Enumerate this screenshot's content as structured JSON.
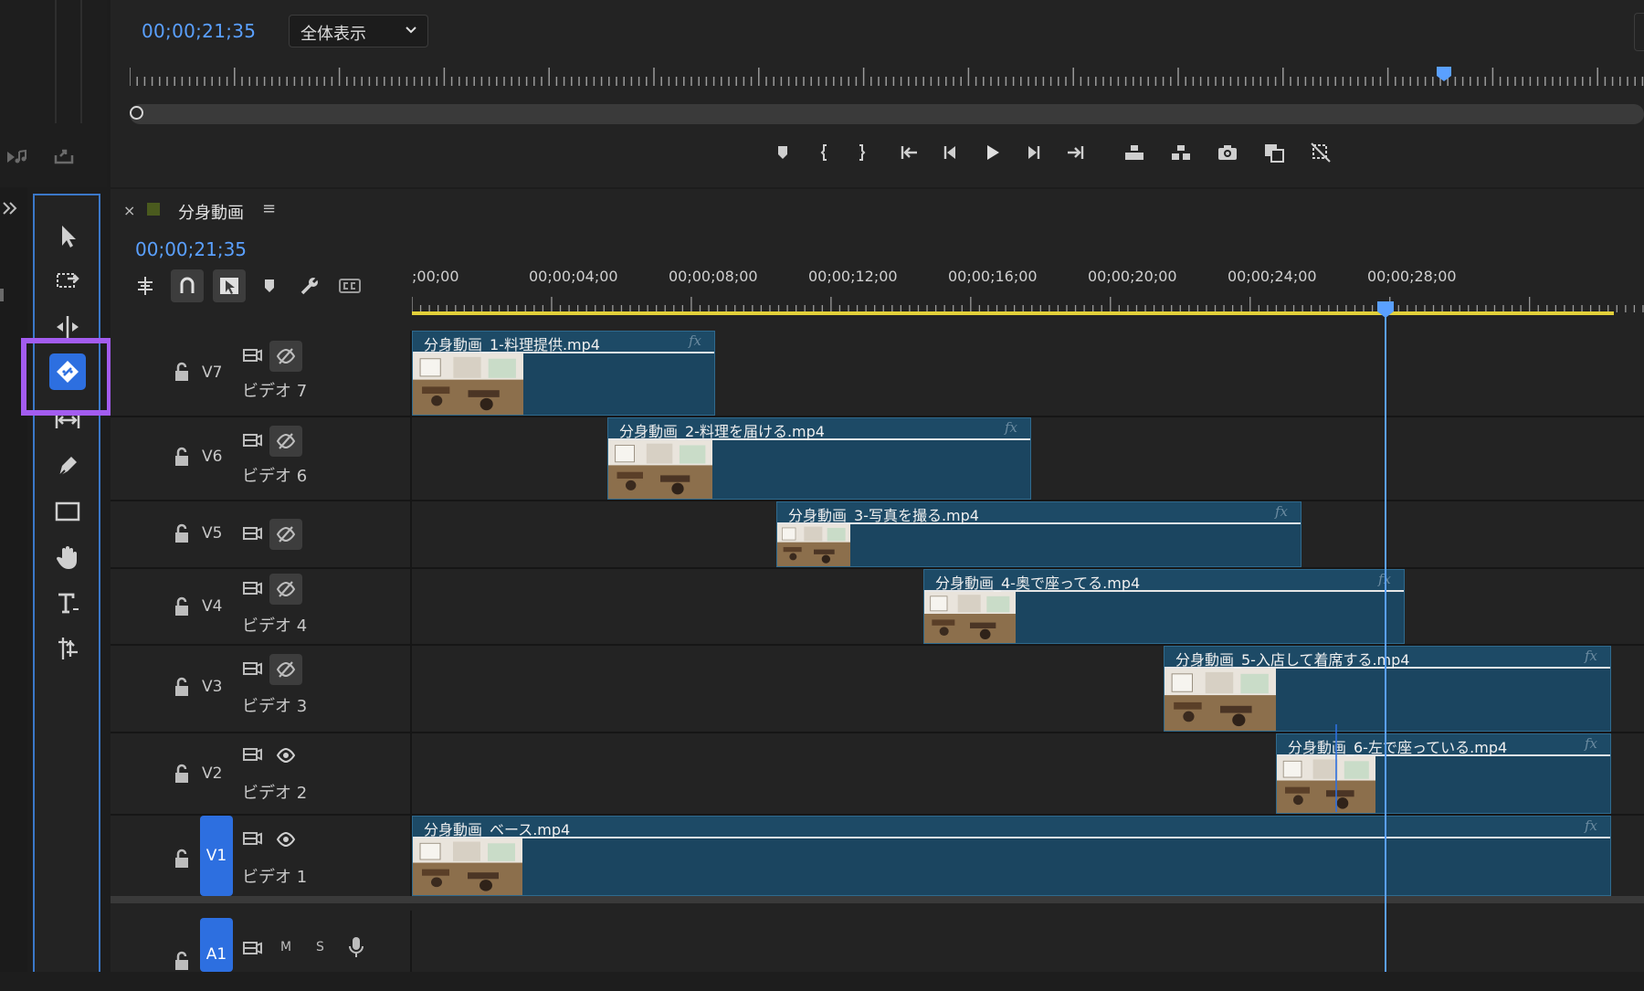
{
  "program_monitor": {
    "timecode": "00;00;21;35",
    "fit_value": "全体表示",
    "transport": [
      {
        "name": "add-marker-icon"
      },
      {
        "name": "mark-in-icon"
      },
      {
        "name": "mark-out-icon"
      },
      {
        "name": "go-to-in-icon"
      },
      {
        "name": "step-back-icon"
      },
      {
        "name": "play-icon"
      },
      {
        "name": "step-forward-icon"
      },
      {
        "name": "go-to-out-icon"
      },
      {
        "name": "lift-icon"
      },
      {
        "name": "extract-icon"
      },
      {
        "name": "export-frame-icon"
      },
      {
        "name": "comparison-view-icon"
      },
      {
        "name": "proxy-toggle-icon"
      }
    ]
  },
  "tools": {
    "items": [
      {
        "name": "selection-tool-icon"
      },
      {
        "name": "track-select-tool-icon"
      },
      {
        "name": "ripple-edit-tool-icon"
      },
      {
        "name": "razor-tool-icon",
        "active": true
      },
      {
        "name": "slip-tool-icon"
      },
      {
        "name": "pen-tool-icon"
      },
      {
        "name": "rectangle-tool-icon"
      },
      {
        "name": "hand-tool-icon"
      },
      {
        "name": "type-tool-icon"
      },
      {
        "name": "remix-tool-icon"
      }
    ],
    "highlight_color": "#a35cf0"
  },
  "timeline": {
    "sequence_name": "分身動画",
    "close_label": "×",
    "menu_label": "≡",
    "timecode": "00;00;21;35",
    "ruler_labels": [
      ";00;00",
      "00;00;04;00",
      "00;00;08;00",
      "00;00;12;00",
      "00;00;16;00",
      "00;00;20;00",
      "00;00;24;00",
      "00;00;28;00"
    ],
    "tracks": [
      {
        "id": "V7",
        "label": "ビデオ 7",
        "visible": false
      },
      {
        "id": "V6",
        "label": "ビデオ 6",
        "visible": false
      },
      {
        "id": "V5",
        "label": "",
        "visible": false
      },
      {
        "id": "V4",
        "label": "ビデオ 4",
        "visible": false
      },
      {
        "id": "V3",
        "label": "ビデオ 3",
        "visible": false
      },
      {
        "id": "V2",
        "label": "ビデオ 2",
        "visible": true
      },
      {
        "id": "V1",
        "label": "ビデオ 1",
        "visible": true
      },
      {
        "id": "A1",
        "label": "",
        "mute": "M",
        "solo": "S"
      }
    ],
    "clips": [
      {
        "track": "V7",
        "name": "分身動画_1-料理提供.mp4",
        "fx": "fx"
      },
      {
        "track": "V6",
        "name": "分身動画_2-料理を届ける.mp4",
        "fx": "fx"
      },
      {
        "track": "V5",
        "name": "分身動画_3-写真を撮る.mp4",
        "fx": "fx"
      },
      {
        "track": "V4",
        "name": "分身動画_4-奥で座ってる.mp4",
        "fx": "fx"
      },
      {
        "track": "V3",
        "name": "分身動画_5-入店して着席する.mp4",
        "fx": "fx"
      },
      {
        "track": "V2",
        "name": "分身動画_6-左で座っている.mp4",
        "fx": "fx"
      },
      {
        "track": "V1",
        "name": "分身動画_ベース.mp4",
        "fx": "fx"
      }
    ],
    "colors": {
      "clip": "#1b4560",
      "playhead": "#5aa0ff",
      "target": "#2d6fe0",
      "work_area": "#e2d03a"
    }
  }
}
